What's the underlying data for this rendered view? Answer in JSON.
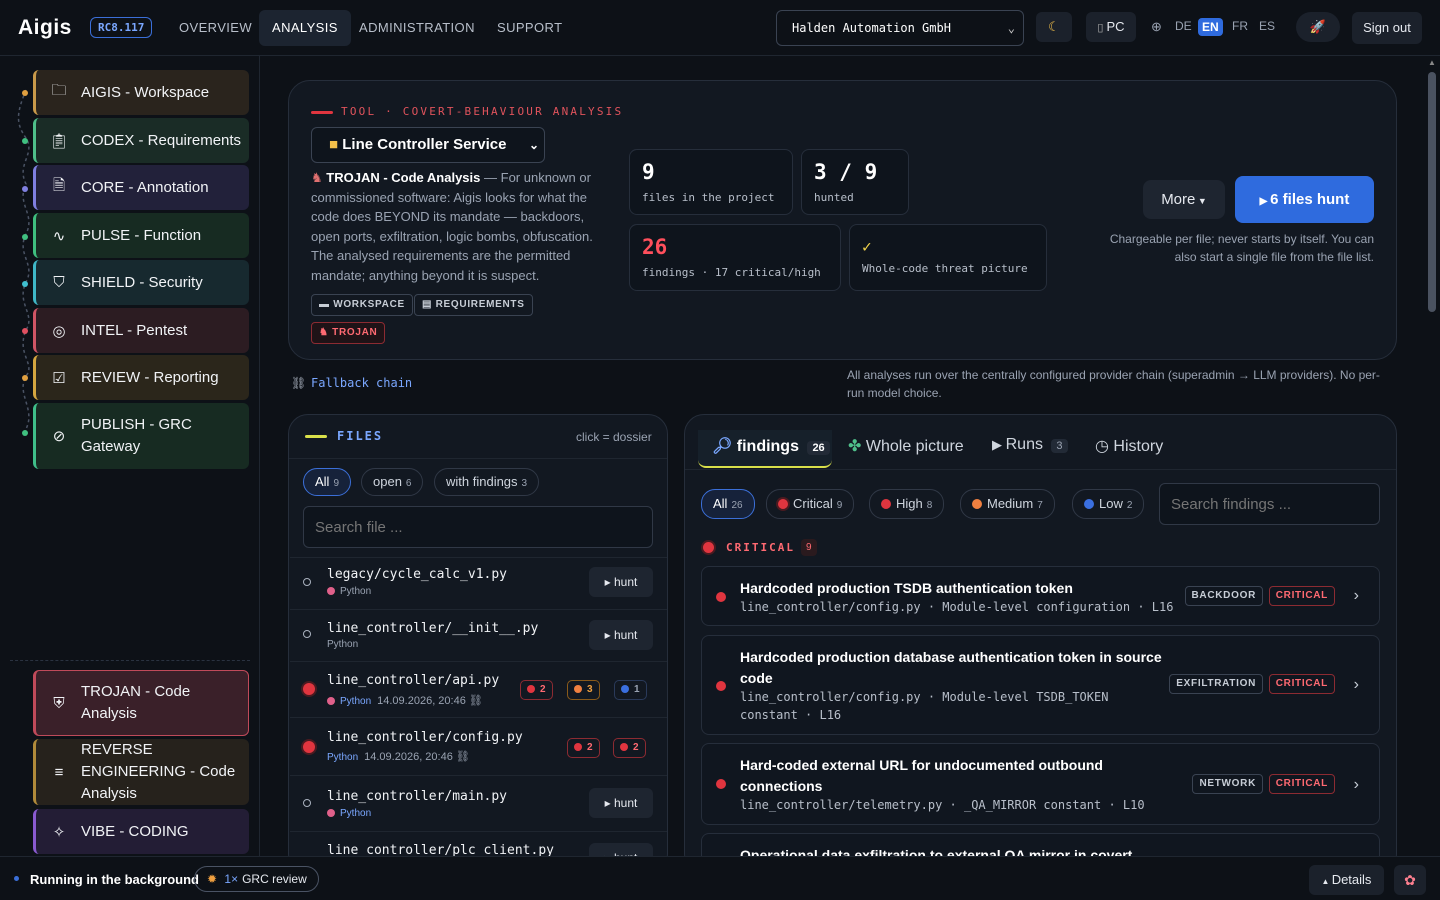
{
  "header": {
    "logo": "Aigis",
    "version": "RC8.117",
    "nav": [
      "OVERVIEW",
      "ANALYSIS",
      "ADMINISTRATION",
      "SUPPORT"
    ],
    "company": "Halden Automation GmbH",
    "theme_icon": "moon-icon",
    "device": "PC",
    "langs": [
      "DE",
      "EN",
      "FR",
      "ES"
    ],
    "active_lang": "EN",
    "sign_out": "Sign out"
  },
  "sidebar": {
    "items": [
      {
        "label": "AIGIS - Workspace",
        "icon": "folder-icon",
        "color": "#c99a4a"
      },
      {
        "label": "CODEX - Requirements",
        "icon": "clipboard-icon",
        "color": "#4fbf8a"
      },
      {
        "label": "CORE - Annotation",
        "icon": "document-icon",
        "color": "#7f7fe0"
      },
      {
        "label": "PULSE - Function",
        "icon": "pulse-icon",
        "color": "#3fbf7f"
      },
      {
        "label": "SHIELD - Security",
        "icon": "shield-icon",
        "color": "#3fb7c7"
      },
      {
        "label": "INTEL - Pentest",
        "icon": "target-icon",
        "color": "#d05565"
      },
      {
        "label": "REVIEW - Reporting",
        "icon": "checklist-icon",
        "color": "#d4a640"
      },
      {
        "label": "PUBLISH - GRC Gateway",
        "icon": "compass-icon",
        "color": "#3fbf8a"
      }
    ],
    "tools": [
      {
        "label": "TROJAN - Code Analysis",
        "icon": "shield-lock-icon",
        "color": "#c04a5a"
      },
      {
        "label": "REVERSE ENGINEERING - Code Analysis",
        "icon": "search-code-icon",
        "color": "#b08a3a"
      },
      {
        "label": "VIBE - CODING",
        "icon": "sparkle-icon",
        "color": "#8a5ad0"
      }
    ]
  },
  "tool": {
    "eyebrow": "TOOL · COVERT-BEHAVIOUR ANALYSIS",
    "project": "Line Controller Service",
    "title": "TROJAN - Code Analysis",
    "desc": "— For unknown or commissioned software: Aigis looks for what the code does BEYOND its mandate — backdoors, open ports, exfiltration, logic bombs, obfuscation. The analysed requirements are the permitted mandate; anything beyond it is suspect.",
    "tags": [
      "WORKSPACE",
      "REQUIREMENTS"
    ],
    "active_tag": "TROJAN",
    "stats": [
      {
        "n": "9",
        "s": "files in the project"
      },
      {
        "n": "3 / 9",
        "s": "hunted"
      },
      {
        "n": "26",
        "s": "findings · 17 critical/high"
      },
      {
        "n": "✓",
        "s": "Whole-code threat picture"
      }
    ],
    "more": "More",
    "hunt_button": "6 files hunt",
    "hunt_note": "Chargeable per file; never starts by itself. You can also start a single file from the file list."
  },
  "fallback": {
    "label": "Fallback chain",
    "note": "All analyses run over the centrally configured provider chain (superadmin → LLM providers). No per-run model choice."
  },
  "files": {
    "title": "FILES",
    "hint": "click = dossier",
    "filters": [
      {
        "label": "All",
        "count": "9"
      },
      {
        "label": "open",
        "count": "6"
      },
      {
        "label": "with findings",
        "count": "3"
      }
    ],
    "search_placeholder": "Search file ...",
    "hunt_label": "hunt",
    "rows": [
      {
        "name": "legacy/cycle_calc_v1.py",
        "lang": "Python",
        "date": ""
      },
      {
        "name": "line_controller/__init__.py",
        "lang": "Python",
        "date": ""
      },
      {
        "name": "line_controller/api.py",
        "lang": "Python",
        "date": "14.09.2026, 20:46",
        "b": [
          "2",
          "3",
          "1"
        ]
      },
      {
        "name": "line_controller/config.py",
        "lang": "Python",
        "date": "14.09.2026, 20:46",
        "b": [
          "2",
          "2"
        ]
      },
      {
        "name": "line_controller/main.py",
        "lang": "Python",
        "date": ""
      },
      {
        "name": "line_controller/plc_client.py",
        "lang": "",
        "date": ""
      }
    ]
  },
  "findings": {
    "tabs": [
      {
        "label": "findings",
        "count": "26"
      },
      {
        "label": "Whole picture",
        "count": ""
      },
      {
        "label": "Runs",
        "count": "3"
      },
      {
        "label": "History",
        "count": ""
      }
    ],
    "filters": [
      {
        "label": "All",
        "count": "26"
      },
      {
        "label": "Critical",
        "count": "9"
      },
      {
        "label": "High",
        "count": "8"
      },
      {
        "label": "Medium",
        "count": "7"
      },
      {
        "label": "Low",
        "count": "2"
      }
    ],
    "search_placeholder": "Search findings ...",
    "section": "CRITICAL",
    "section_count": "9",
    "items": [
      {
        "title": "Hardcoded production TSDB authentication token",
        "meta": "line_controller/config.py · Module-level configuration · L16",
        "cat": "BACKDOOR",
        "sev": "CRITICAL"
      },
      {
        "title": "Hardcoded production database authentication token in source code",
        "meta": "line_controller/config.py · Module-level TSDB_TOKEN constant · L16",
        "cat": "EXFILTRATION",
        "sev": "CRITICAL"
      },
      {
        "title": "Hard-coded external URL for undocumented outbound connections",
        "meta": "line_controller/telemetry.py · _QA_MIRROR constant · L10",
        "cat": "NETWORK",
        "sev": "CRITICAL"
      },
      {
        "title": "Operational data exfiltration to external QA mirror in covert",
        "meta": "",
        "cat": "",
        "sev": ""
      }
    ]
  },
  "footer": {
    "status": "Running in the background",
    "job_count": "1×",
    "job": "GRC review",
    "details": "Details"
  }
}
